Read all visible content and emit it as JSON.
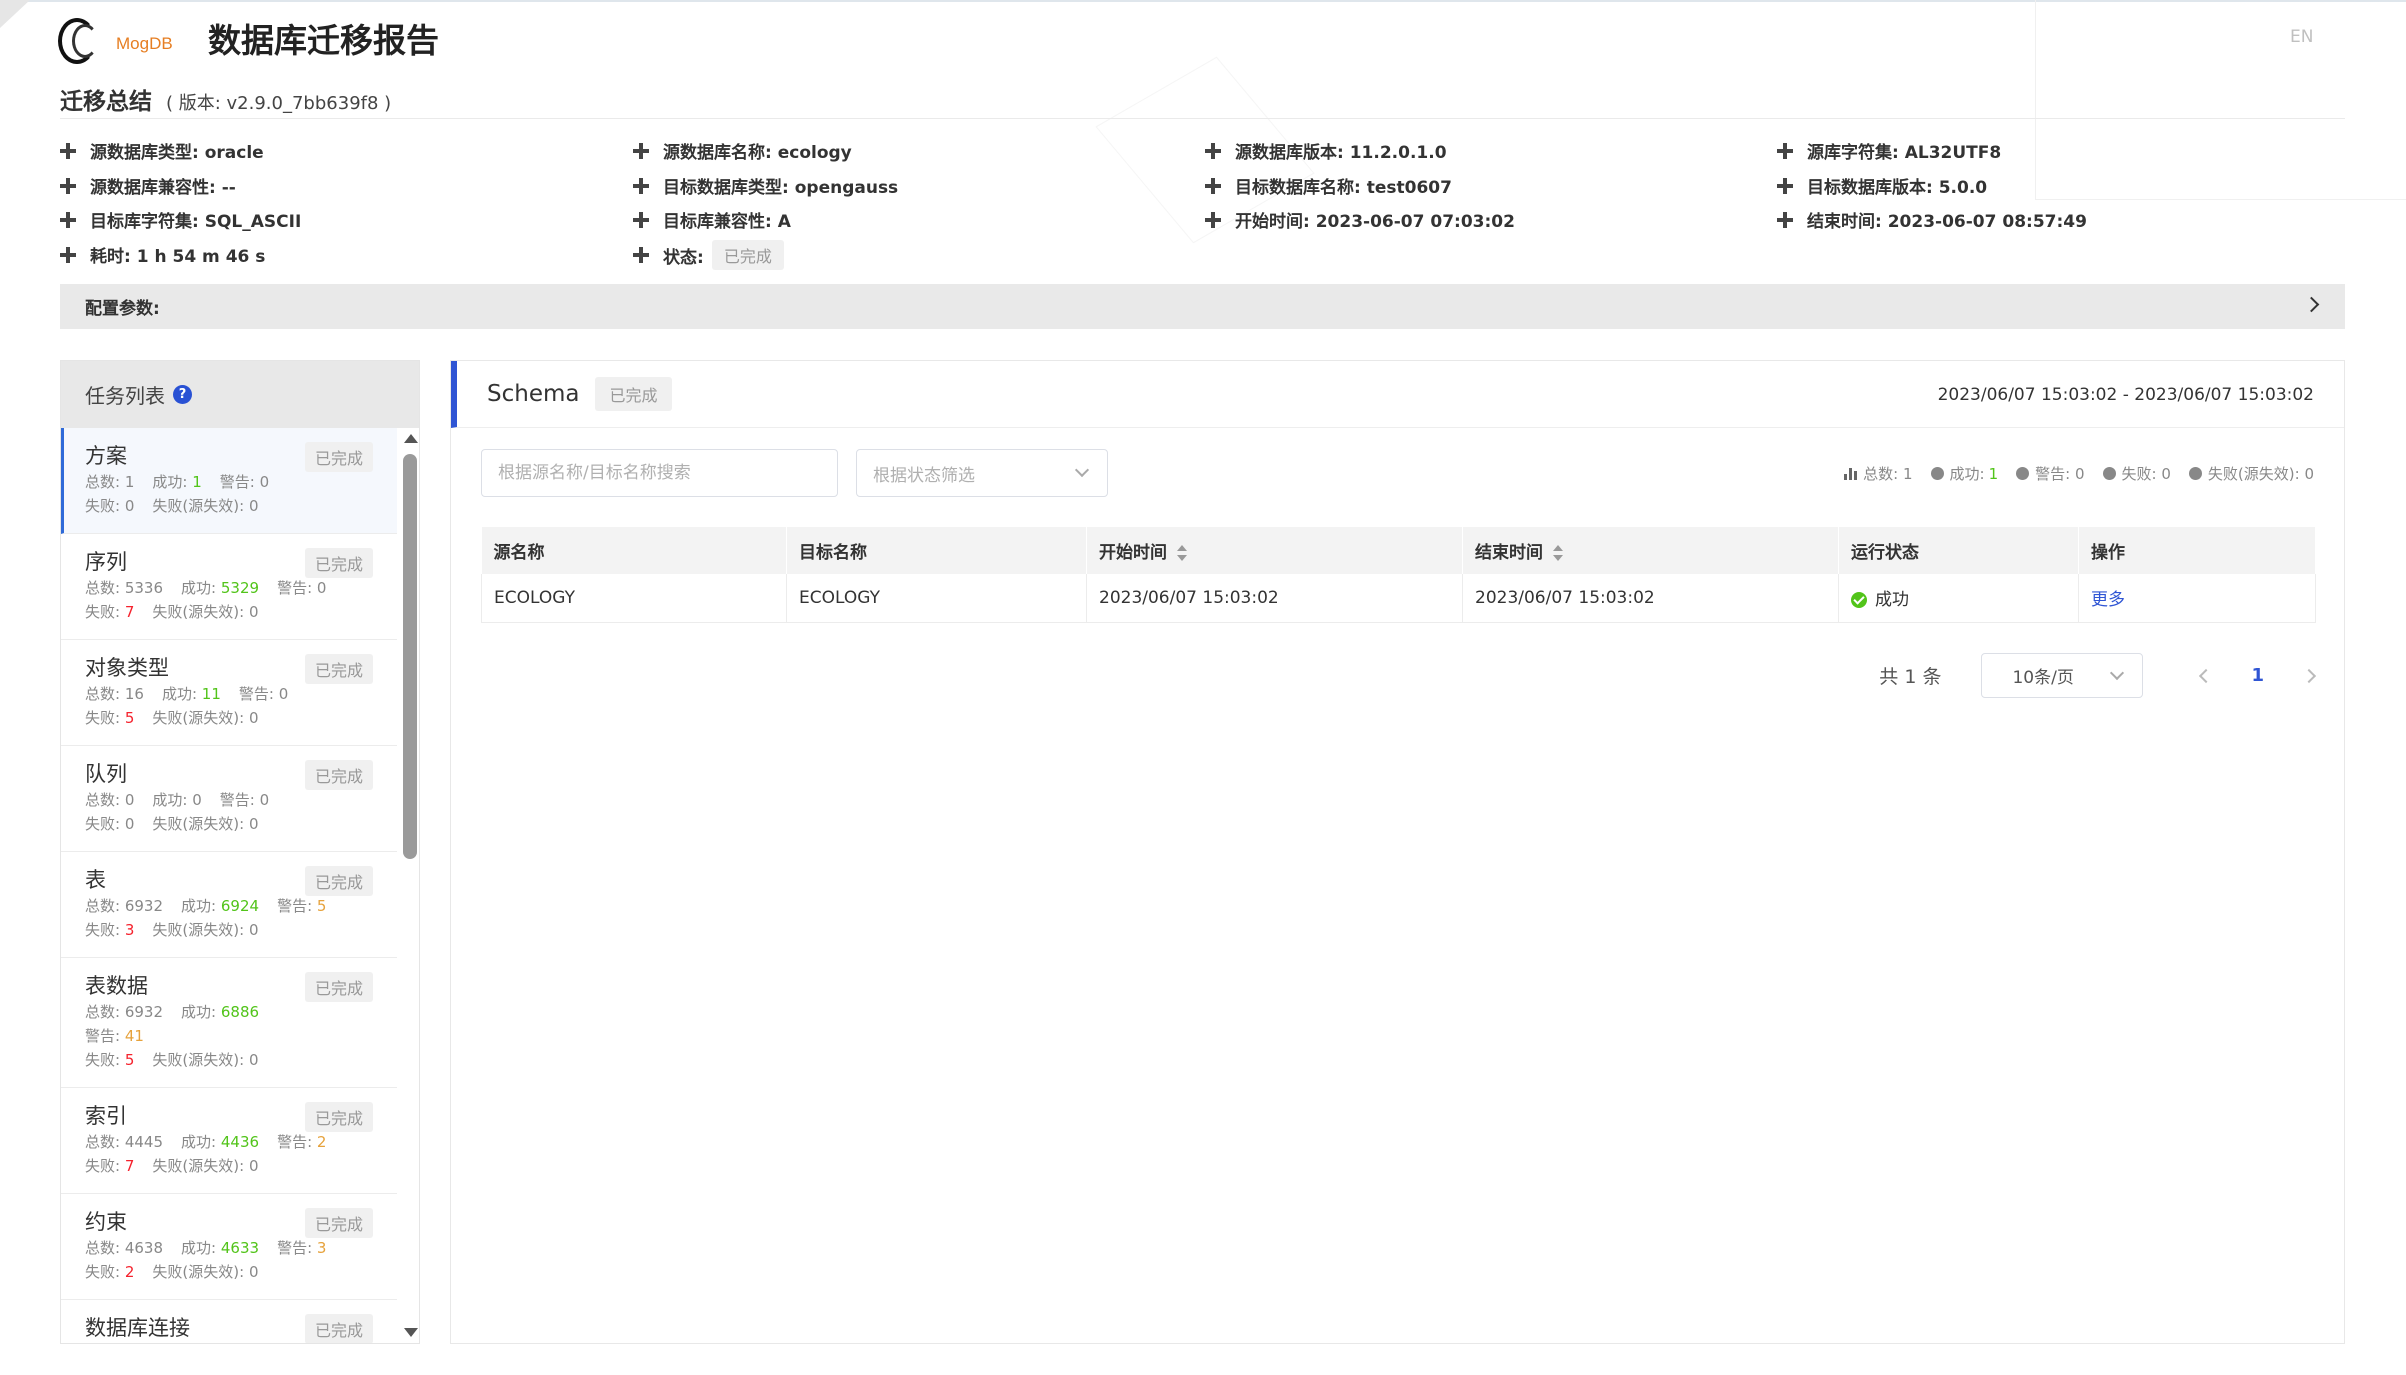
{
  "header": {
    "logo_text": "MogDB",
    "title": "数据库迁移报告",
    "lang": "EN"
  },
  "summary": {
    "title": "迁移总结",
    "version": "( 版本: v2.9.0_7bb639f8 )",
    "items": [
      "源数据库类型: oracle",
      "源数据库名称: ecology",
      "源数据库版本: 11.2.0.1.0",
      "源库字符集: AL32UTF8",
      "源数据库兼容性: --",
      "目标数据库类型: opengauss",
      "目标数据库名称: test0607",
      "目标数据库版本: 5.0.0",
      "目标库字符集: SQL_ASCII",
      "目标库兼容性: A",
      "开始时间: 2023-06-07 07:03:02",
      "结束时间: 2023-06-07 08:57:49",
      "耗时: 1 h 54 m 46 s"
    ],
    "status_label": "状态:",
    "status_value": "已完成"
  },
  "config": {
    "label": "配置参数:"
  },
  "task_list": {
    "title": "任务列表",
    "help": "?",
    "tasks": [
      {
        "name": "方案",
        "tag": "已完成",
        "total_label": "总数:",
        "total": "1",
        "success_label": "成功:",
        "success": "1",
        "warn_label": "警告:",
        "warn": "0",
        "fail_label": "失败:",
        "fail": "0",
        "fail_src_label": "失败(源失效):",
        "fail_src": "0"
      },
      {
        "name": "序列",
        "tag": "已完成",
        "total_label": "总数:",
        "total": "5336",
        "success_label": "成功:",
        "success": "5329",
        "warn_label": "警告:",
        "warn": "0",
        "fail_label": "失败:",
        "fail": "7",
        "fail_src_label": "失败(源失效):",
        "fail_src": "0"
      },
      {
        "name": "对象类型",
        "tag": "已完成",
        "total_label": "总数:",
        "total": "16",
        "success_label": "成功:",
        "success": "11",
        "warn_label": "警告:",
        "warn": "0",
        "fail_label": "失败:",
        "fail": "5",
        "fail_src_label": "失败(源失效):",
        "fail_src": "0"
      },
      {
        "name": "队列",
        "tag": "已完成",
        "total_label": "总数:",
        "total": "0",
        "success_label": "成功:",
        "success": "0",
        "warn_label": "警告:",
        "warn": "0",
        "fail_label": "失败:",
        "fail": "0",
        "fail_src_label": "失败(源失效):",
        "fail_src": "0"
      },
      {
        "name": "表",
        "tag": "已完成",
        "total_label": "总数:",
        "total": "6932",
        "success_label": "成功:",
        "success": "6924",
        "warn_label": "警告:",
        "warn": "5",
        "fail_label": "失败:",
        "fail": "3",
        "fail_src_label": "失败(源失效):",
        "fail_src": "0"
      },
      {
        "name": "表数据",
        "tag": "已完成",
        "total_label": "总数:",
        "total": "6932",
        "success_label": "成功:",
        "success": "6886",
        "warn_label": "警告:",
        "warn": "41",
        "fail_label": "失败:",
        "fail": "5",
        "fail_src_label": "失败(源失效):",
        "fail_src": "0"
      },
      {
        "name": "索引",
        "tag": "已完成",
        "total_label": "总数:",
        "total": "4445",
        "success_label": "成功:",
        "success": "4436",
        "warn_label": "警告:",
        "warn": "2",
        "fail_label": "失败:",
        "fail": "7",
        "fail_src_label": "失败(源失效):",
        "fail_src": "0"
      },
      {
        "name": "约束",
        "tag": "已完成",
        "total_label": "总数:",
        "total": "4638",
        "success_label": "成功:",
        "success": "4633",
        "warn_label": "警告:",
        "warn": "3",
        "fail_label": "失败:",
        "fail": "2",
        "fail_src_label": "失败(源失效):",
        "fail_src": "0"
      },
      {
        "name": "数据库连接",
        "tag": "已完成"
      }
    ]
  },
  "detail": {
    "name": "Schema",
    "tag": "已完成",
    "time_range": "2023/06/07 15:03:02 - 2023/06/07 15:03:02",
    "search_placeholder": "根据源名称/目标名称搜索",
    "status_filter_placeholder": "根据状态筛选",
    "stats": {
      "total_label": "总数:",
      "total": "1",
      "success_label": "成功:",
      "success": "1",
      "warn_label": "警告:",
      "warn": "0",
      "fail_label": "失败:",
      "fail": "0",
      "fail_src_label": "失败(源失效):",
      "fail_src": "0"
    },
    "table": {
      "columns": [
        "源名称",
        "目标名称",
        "开始时间",
        "结束时间",
        "运行状态",
        "操作"
      ],
      "rows": [
        {
          "source": "ECOLOGY",
          "target": "ECOLOGY",
          "start": "2023/06/07 15:03:02",
          "end": "2023/06/07 15:03:02",
          "status": "成功",
          "action": "更多"
        }
      ]
    },
    "pager": {
      "total": "共 1 条",
      "page_size": "10条/页",
      "current_page": "1"
    }
  },
  "colors": {
    "accent": "#2f55d4",
    "success": "#52c41a",
    "warning": "#e6a23c",
    "danger": "#f5222d"
  }
}
